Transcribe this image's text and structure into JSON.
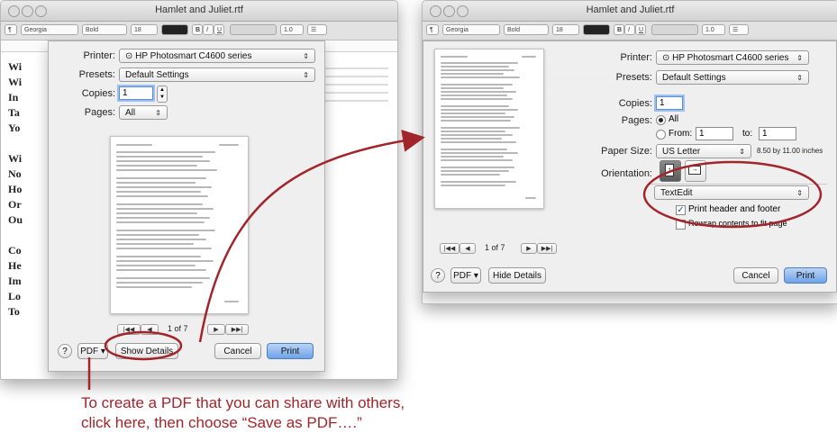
{
  "window_title": "Hamlet and Juliet.rtf",
  "toolbar": {
    "font_name": "Georgia",
    "font_style": "Bold",
    "font_size": "18",
    "bold": "B",
    "italic": "I",
    "underline": "U",
    "spacing": "1.0",
    "list": "☰"
  },
  "document_lines": [
    "Wi",
    "Wi",
    "In",
    "Ta",
    "Yo",
    "Wi",
    "No",
    "Ho",
    "Or",
    "Ou",
    "Co",
    "He",
    "Im",
    "Lo",
    "To"
  ],
  "print_dialog_left": {
    "printer_label": "Printer:",
    "printer_value": "⊙ HP Photosmart C4600 series",
    "presets_label": "Presets:",
    "presets_value": "Default Settings",
    "copies_label": "Copies:",
    "copies_value": "1",
    "pages_label": "Pages:",
    "pages_value": "All",
    "page_count": "1 of 7",
    "nav_first": "|◀◀",
    "nav_prev": "◀",
    "nav_next": "▶",
    "nav_last": "▶▶|",
    "help": "?",
    "pdf_label": "PDF ▾",
    "show_details": "Show Details",
    "cancel": "Cancel",
    "print": "Print"
  },
  "print_dialog_right": {
    "printer_label": "Printer:",
    "printer_value": "⊙ HP Photosmart C4600 series",
    "presets_label": "Presets:",
    "presets_value": "Default Settings",
    "copies_label": "Copies:",
    "copies_value": "1",
    "pages_label": "Pages:",
    "pages_all": "All",
    "pages_from_label": "From:",
    "pages_from_value": "1",
    "pages_to_label": "to:",
    "pages_to_value": "1",
    "paper_size_label": "Paper Size:",
    "paper_size_value": "US Letter",
    "paper_dims": "8.50 by 11.00 inches",
    "orientation_label": "Orientation:",
    "app_menu_value": "TextEdit",
    "print_header_footer": "Print header and footer",
    "rewrap_contents": "Rewrap contents to fit page",
    "page_count": "1 of 7",
    "nav_first": "|◀◀",
    "nav_prev": "◀",
    "nav_next": "▶",
    "nav_last": "▶▶|",
    "help": "?",
    "pdf_label": "PDF ▾",
    "hide_details": "Hide Details",
    "cancel": "Cancel",
    "print": "Print"
  },
  "annotation": {
    "line1": "To create a PDF that you can share with others,",
    "line2": "click here, then choose “Save as PDF….”"
  },
  "colors": {
    "annotation_red": "#a2252b",
    "print_button_blue": "#6fa2e6"
  }
}
